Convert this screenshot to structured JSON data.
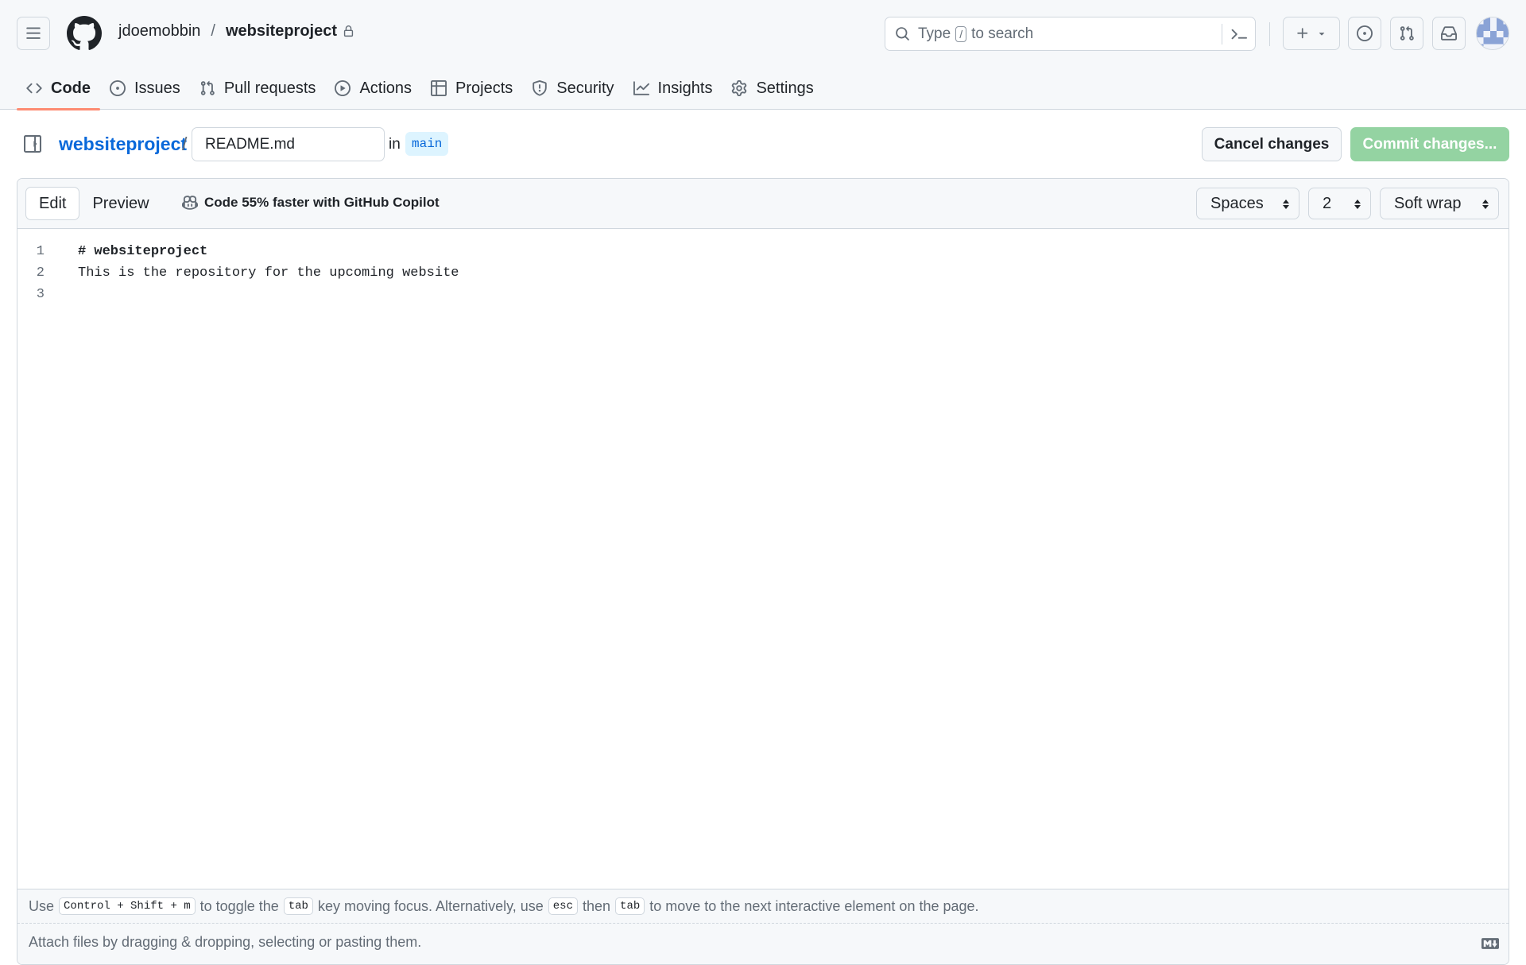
{
  "header": {
    "owner": "jdoemobbin",
    "separator": "/",
    "repo": "websiteproject",
    "search": {
      "prefix": "Type",
      "key": "/",
      "suffix": "to search"
    }
  },
  "nav": {
    "tabs": [
      {
        "label": "Code",
        "icon": "code-icon",
        "active": true
      },
      {
        "label": "Issues",
        "icon": "issue-opened-icon"
      },
      {
        "label": "Pull requests",
        "icon": "git-pull-request-icon"
      },
      {
        "label": "Actions",
        "icon": "play-icon"
      },
      {
        "label": "Projects",
        "icon": "table-icon"
      },
      {
        "label": "Security",
        "icon": "shield-icon"
      },
      {
        "label": "Insights",
        "icon": "graph-icon"
      },
      {
        "label": "Settings",
        "icon": "gear-icon"
      }
    ]
  },
  "file": {
    "repo_link": "websiteproject",
    "slash": "/",
    "filename": "README.md",
    "in_label": "in",
    "branch": "main",
    "cancel_label": "Cancel changes",
    "commit_label": "Commit changes..."
  },
  "editor": {
    "edit_label": "Edit",
    "preview_label": "Preview",
    "copilot_text": "Code 55% faster with GitHub Copilot",
    "indent_mode": "Spaces",
    "indent_size": "2",
    "wrap_mode": "Soft wrap",
    "lines": [
      {
        "number": "1",
        "text": "# websiteproject"
      },
      {
        "number": "2",
        "text": "This is the repository for the upcoming website"
      },
      {
        "number": "3",
        "text": ""
      }
    ],
    "hint": {
      "use": "Use",
      "shortcut": "Control + Shift + m",
      "toggle": "to toggle the",
      "tab_key": "tab",
      "moving": "key moving focus. Alternatively, use",
      "esc_key": "esc",
      "then": "then",
      "tab_key2": "tab",
      "rest": "to move to the next interactive element on the page."
    },
    "attach_text": "Attach files by dragging & dropping, selecting or pasting them."
  },
  "colors": {
    "accent": "#0969da",
    "active_tab_underline": "#fd8c73",
    "commit_button_disabled": "#94d3a2",
    "branch_bg": "#ddf4ff"
  }
}
